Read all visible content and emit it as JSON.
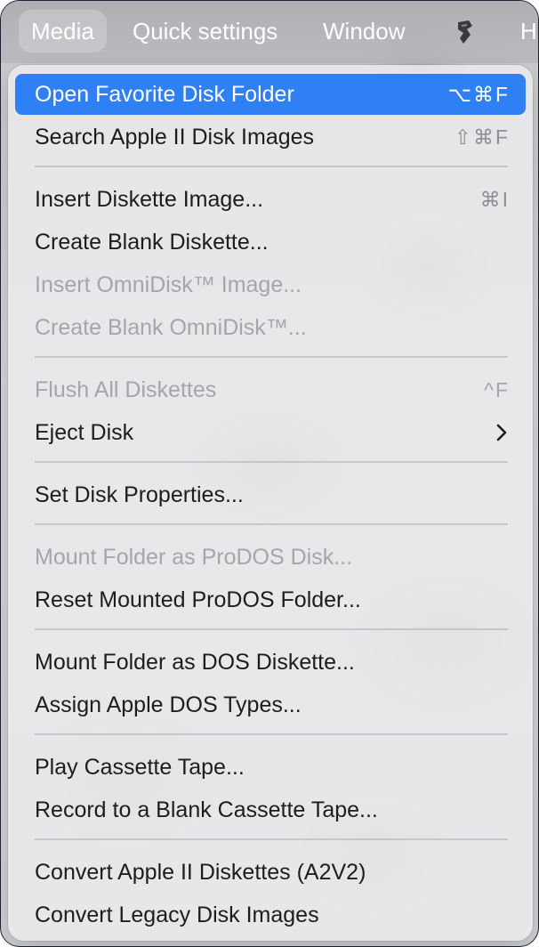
{
  "menubar": {
    "items": [
      {
        "label": "Media",
        "active": true
      },
      {
        "label": "Quick settings",
        "active": false
      },
      {
        "label": "Window",
        "active": false
      },
      {
        "label": "H",
        "active": false
      }
    ],
    "icon": "script-icon"
  },
  "menu": {
    "items": [
      {
        "label": "Open Favorite Disk Folder",
        "shortcut": "⌥⌘F",
        "state": "highlighted"
      },
      {
        "label": "Search Apple II Disk Images",
        "shortcut": "⇧⌘F",
        "state": "enabled"
      },
      {
        "label": "Insert Diskette Image...",
        "shortcut": "⌘I",
        "state": "enabled"
      },
      {
        "label": "Create Blank Diskette...",
        "shortcut": "",
        "state": "enabled"
      },
      {
        "label": "Insert OmniDisk™ Image...",
        "shortcut": "",
        "state": "disabled"
      },
      {
        "label": "Create Blank OmniDisk™...",
        "shortcut": "",
        "state": "disabled"
      },
      {
        "label": "Flush All Diskettes",
        "shortcut": "^F",
        "state": "disabled"
      },
      {
        "label": "Eject Disk",
        "shortcut": "",
        "state": "enabled",
        "submenu": true
      },
      {
        "label": "Set Disk Properties...",
        "shortcut": "",
        "state": "enabled"
      },
      {
        "label": "Mount Folder as ProDOS Disk...",
        "shortcut": "",
        "state": "disabled"
      },
      {
        "label": "Reset Mounted ProDOS Folder...",
        "shortcut": "",
        "state": "enabled"
      },
      {
        "label": "Mount Folder as DOS Diskette...",
        "shortcut": "",
        "state": "enabled"
      },
      {
        "label": "Assign Apple DOS Types...",
        "shortcut": "",
        "state": "enabled"
      },
      {
        "label": "Play Cassette Tape...",
        "shortcut": "",
        "state": "enabled"
      },
      {
        "label": "Record to a Blank Cassette Tape...",
        "shortcut": "",
        "state": "enabled"
      },
      {
        "label": "Convert Apple II Diskettes (A2V2)",
        "shortcut": "",
        "state": "enabled"
      },
      {
        "label": "Convert Legacy Disk Images",
        "shortcut": "",
        "state": "enabled"
      }
    ]
  },
  "colors": {
    "highlight": "#2f7ff5",
    "text": "#1d1d1f",
    "disabled_text": "#a5a5aa",
    "shortcut_text": "#8e8e93"
  }
}
